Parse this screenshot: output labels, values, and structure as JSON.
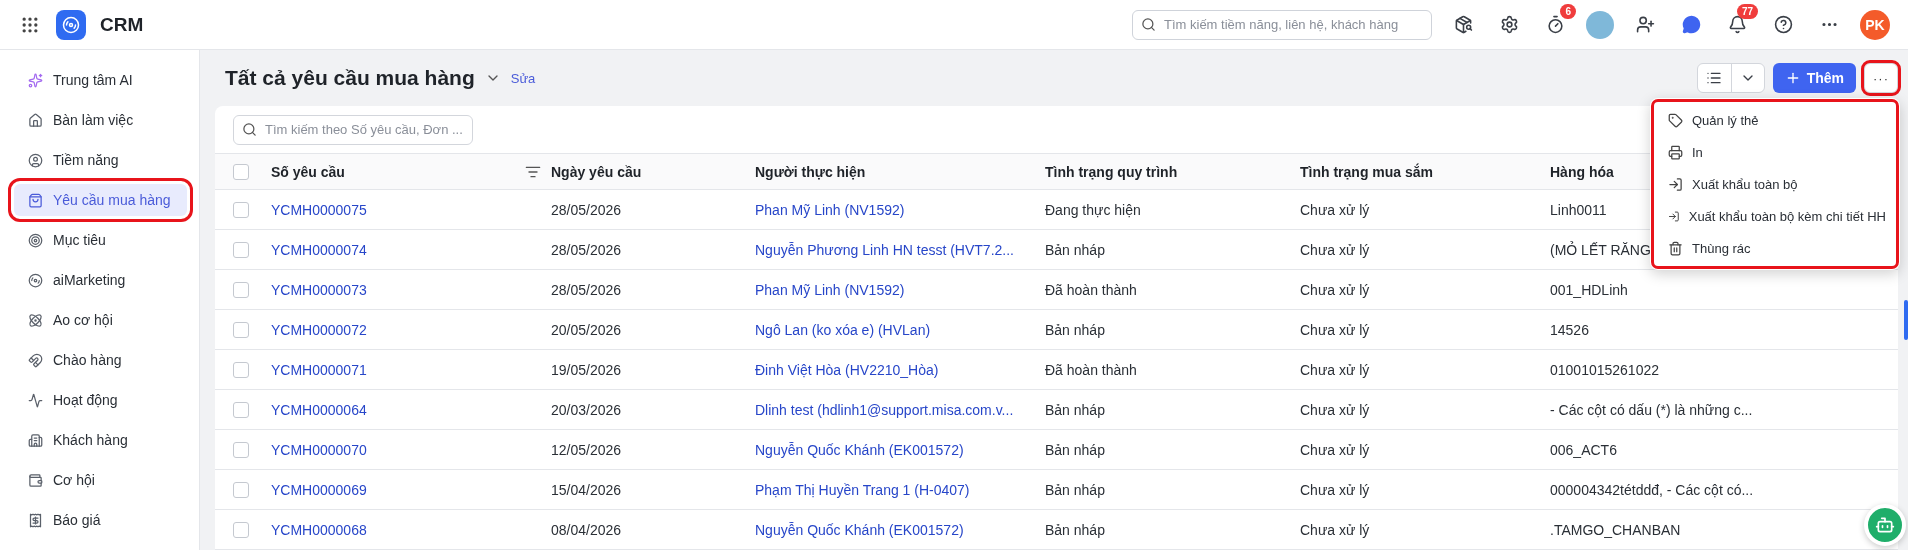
{
  "app": {
    "name": "CRM"
  },
  "search": {
    "placeholder": "Tìm kiếm tiềm năng, liên hệ, khách hàng"
  },
  "header_badges": {
    "timer": "6",
    "notifications": "77"
  },
  "user": {
    "initials": "PK"
  },
  "sidebar": {
    "items": [
      {
        "label": "Trung tâm AI",
        "selected": false,
        "highlighted": false
      },
      {
        "label": "Bàn làm việc",
        "selected": false,
        "highlighted": false
      },
      {
        "label": "Tiềm năng",
        "selected": false,
        "highlighted": false
      },
      {
        "label": "Yêu cầu mua hàng",
        "selected": true,
        "highlighted": true
      },
      {
        "label": "Mục tiêu",
        "selected": false,
        "highlighted": false
      },
      {
        "label": "aiMarketing",
        "selected": false,
        "highlighted": false
      },
      {
        "label": "Ao cơ hội",
        "selected": false,
        "highlighted": false
      },
      {
        "label": "Chào hàng",
        "selected": false,
        "highlighted": false
      },
      {
        "label": "Hoạt động",
        "selected": false,
        "highlighted": false
      },
      {
        "label": "Khách hàng",
        "selected": false,
        "highlighted": false
      },
      {
        "label": "Cơ hội",
        "selected": false,
        "highlighted": false
      },
      {
        "label": "Báo giá",
        "selected": false,
        "highlighted": false
      }
    ]
  },
  "page": {
    "title": "Tất cả yêu cầu mua hàng",
    "edit_link": "Sửa",
    "add_button": "Thêm",
    "more_button": {
      "label": "···",
      "highlighted": true
    }
  },
  "table_search": {
    "placeholder": "Tìm kiếm theo Số yêu cầu, Đơn ..."
  },
  "more_menu": {
    "highlighted": true,
    "items": [
      "Quản lý thẻ",
      "In",
      "Xuất khẩu toàn bộ",
      "Xuất khẩu toàn bộ kèm chi tiết HH",
      "Thùng rác"
    ]
  },
  "table": {
    "select_all_checked": false,
    "columns": [
      "Số yêu cầu",
      "Ngày yêu cầu",
      "Người thực hiện",
      "Tình trạng quy trình",
      "Tình trạng mua sắm",
      "Hàng hóa"
    ],
    "rows": [
      {
        "checked": false,
        "cells": [
          "YCMH0000075",
          "28/05/2026",
          "Phan Mỹ Linh (NV1592)",
          "Đang thực hiện",
          "Chưa xử lý",
          "Linh0011"
        ]
      },
      {
        "checked": false,
        "cells": [
          "YCMH0000074",
          "28/05/2026",
          "Nguyễn Phương Linh HN tesst (HVT7.2...",
          "Bản nháp",
          "Chưa xử lý",
          "(MỎ LẾT RĂNG"
        ]
      },
      {
        "checked": false,
        "cells": [
          "YCMH0000073",
          "28/05/2026",
          "Phan Mỹ Linh (NV1592)",
          "Đã hoàn thành",
          "Chưa xử lý",
          "001_HDLinh"
        ]
      },
      {
        "checked": false,
        "cells": [
          "YCMH0000072",
          "20/05/2026",
          "Ngô Lan (ko xóa e) (HVLan)",
          "Bản nháp",
          "Chưa xử lý",
          "14526"
        ]
      },
      {
        "checked": false,
        "cells": [
          "YCMH0000071",
          "19/05/2026",
          "Đinh Việt Hòa (HV2210_Hòa)",
          "Đã hoàn thành",
          "Chưa xử lý",
          "01001015261022"
        ]
      },
      {
        "checked": false,
        "cells": [
          "YCMH0000064",
          "20/03/2026",
          "Dlinh test (hdlinh1@support.misa.com.v...",
          "Bản nháp",
          "Chưa xử lý",
          "- Các cột có dấu (*) là những c..."
        ]
      },
      {
        "checked": false,
        "cells": [
          "YCMH0000070",
          "12/05/2026",
          "Nguyễn Quốc Khánh (EK001572)",
          "Bản nháp",
          "Chưa xử lý",
          "006_ACT6"
        ]
      },
      {
        "checked": false,
        "cells": [
          "YCMH0000069",
          "15/04/2026",
          "Phạm Thị Huyền Trang 1 (H-0407)",
          "Bản nháp",
          "Chưa xử lý",
          "000004342tétddđ, - Các cột có..."
        ]
      },
      {
        "checked": false,
        "cells": [
          "YCMH0000068",
          "08/04/2026",
          "Nguyễn Quốc Khánh (EK001572)",
          "Bản nháp",
          "Chưa xử lý",
          ".TAMGO_CHANBAN"
        ]
      }
    ]
  }
}
